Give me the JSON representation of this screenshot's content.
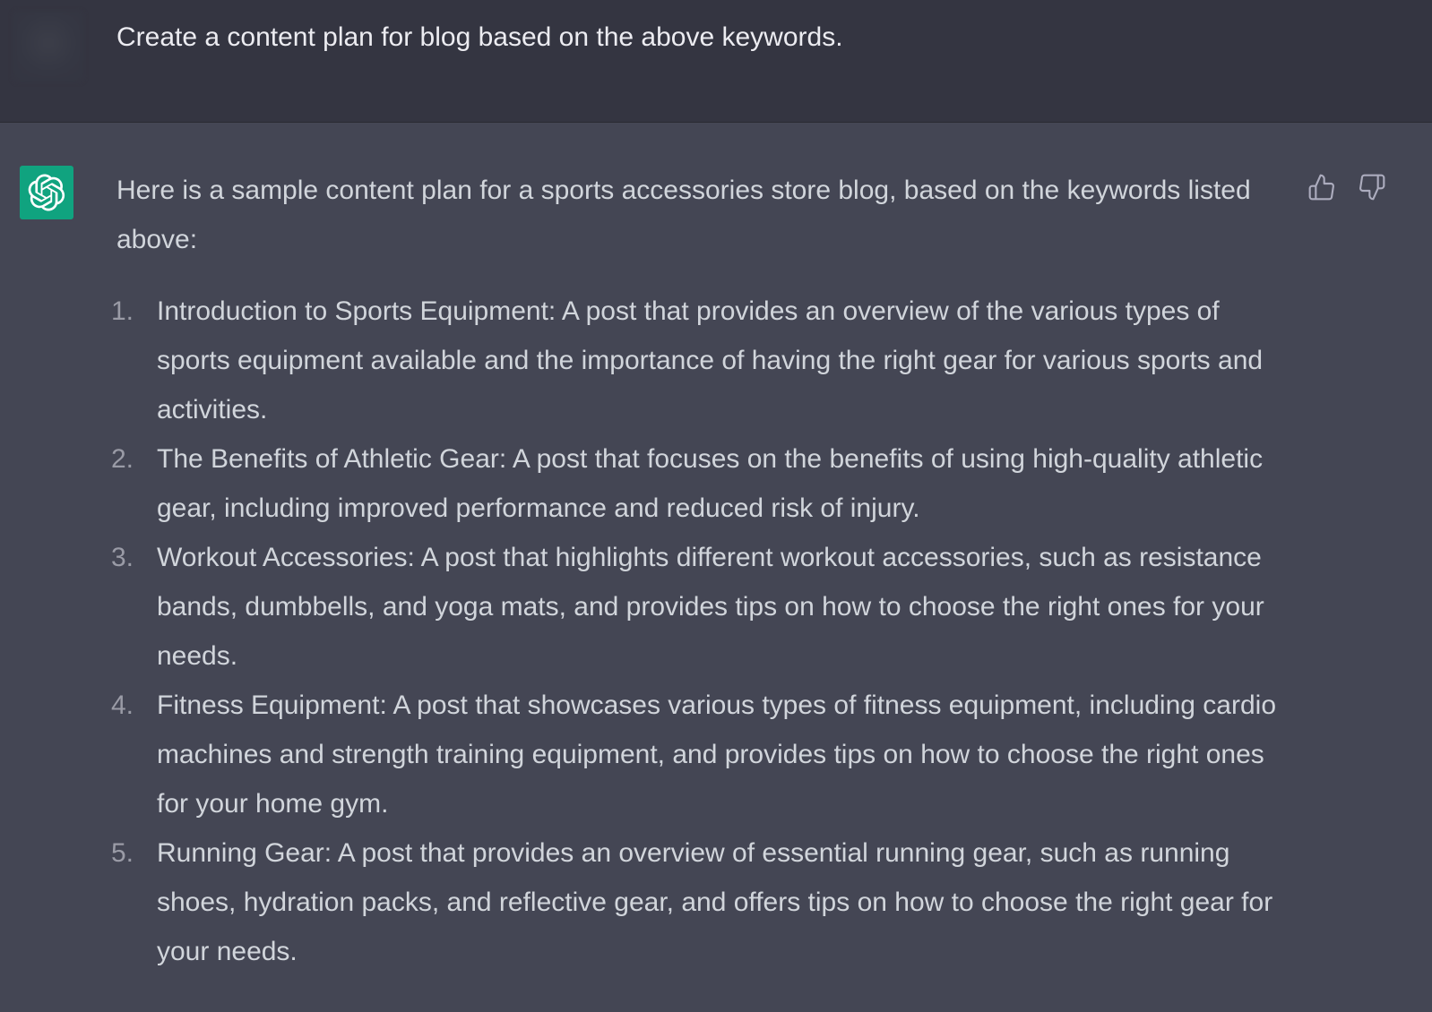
{
  "colors": {
    "user_bg": "#343541",
    "assistant_bg": "#444654",
    "text": "#d1d5db",
    "avatar_bot": "#10a37f"
  },
  "user_message": {
    "avatar_icon": "user-avatar-blurred",
    "text": "Create a content plan for blog based on the above keywords."
  },
  "assistant_message": {
    "avatar_icon": "openai-logo-icon",
    "intro": "Here is a sample content plan for a sports accessories store blog, based on the keywords listed above:",
    "items": [
      {
        "number": "1.",
        "text": "Introduction to Sports Equipment: A post that provides an overview of the various types of sports equipment available and the importance of having the right gear for various sports and activities."
      },
      {
        "number": "2.",
        "text": "The Benefits of Athletic Gear: A post that focuses on the benefits of using high-quality athletic gear, including improved performance and reduced risk of injury."
      },
      {
        "number": "3.",
        "text": "Workout Accessories: A post that highlights different workout accessories, such as resistance bands, dumbbells, and yoga mats, and provides tips on how to choose the right ones for your needs."
      },
      {
        "number": "4.",
        "text": "Fitness Equipment: A post that showcases various types of fitness equipment, including cardio machines and strength training equipment, and provides tips on how to choose the right ones for your home gym."
      },
      {
        "number": "5.",
        "text": "Running Gear: A post that provides an overview of essential running gear, such as running shoes, hydration packs, and reflective gear, and offers tips on how to choose the right gear for your needs."
      }
    ],
    "feedback": {
      "thumbs_up_icon": "thumbs-up-icon",
      "thumbs_down_icon": "thumbs-down-icon"
    }
  }
}
